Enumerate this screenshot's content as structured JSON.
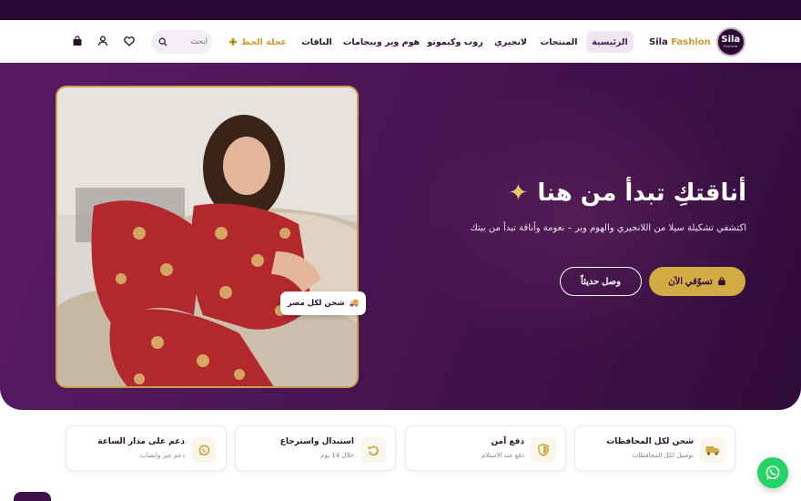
{
  "brand": {
    "name": "Sila",
    "accent_word": "Fashion",
    "logo_big": "Sila",
    "logo_small": "FASHION"
  },
  "nav": {
    "items": [
      {
        "label": "الرئيسية"
      },
      {
        "label": "المنتجات"
      },
      {
        "label": "لانجيري"
      },
      {
        "label": "روب وكيمونو"
      },
      {
        "label": "هوم وير وبيجامات"
      },
      {
        "label": "الباقات"
      },
      {
        "label": "عجلة الحظ"
      }
    ],
    "active_index": 0,
    "wheel_icon": "flower-icon",
    "search_placeholder": "ابحث",
    "icons": [
      "search-icon",
      "heart-icon",
      "user-icon",
      "bag-icon"
    ]
  },
  "hero": {
    "title": "أناقتكِ تبدأ من هنا",
    "title_icon": "sparkle-icon",
    "subtitle": "اكتشفي تشكيلة سيلا من اللانجيري والهوم وير – نعومة وأناقة تبدأ من بيتك",
    "primary_button": "تسوّقي الآن",
    "secondary_button": "وصل حديثاً",
    "badge": "شحن لكل مصر",
    "badge_emoji": "🚚"
  },
  "features": [
    {
      "title": "شحن لكل المحافظات",
      "subtitle": "توصيل لكل المحافظات",
      "icon": "truck-icon"
    },
    {
      "title": "دفع آمن",
      "subtitle": "دفع عند الاستلام",
      "icon": "shield-icon"
    },
    {
      "title": "استبدال واسترجاع",
      "subtitle": "خلال 14 يوم",
      "icon": "return-icon"
    },
    {
      "title": "دعم على مدار الساعة",
      "subtitle": "دعم عبر واتساب",
      "icon": "whatsapp-icon"
    }
  ],
  "colors": {
    "topbar": "#2a0a33",
    "hero_purple": "#4c1657",
    "gold": "#d3ab45",
    "whatsapp": "#25d366"
  }
}
